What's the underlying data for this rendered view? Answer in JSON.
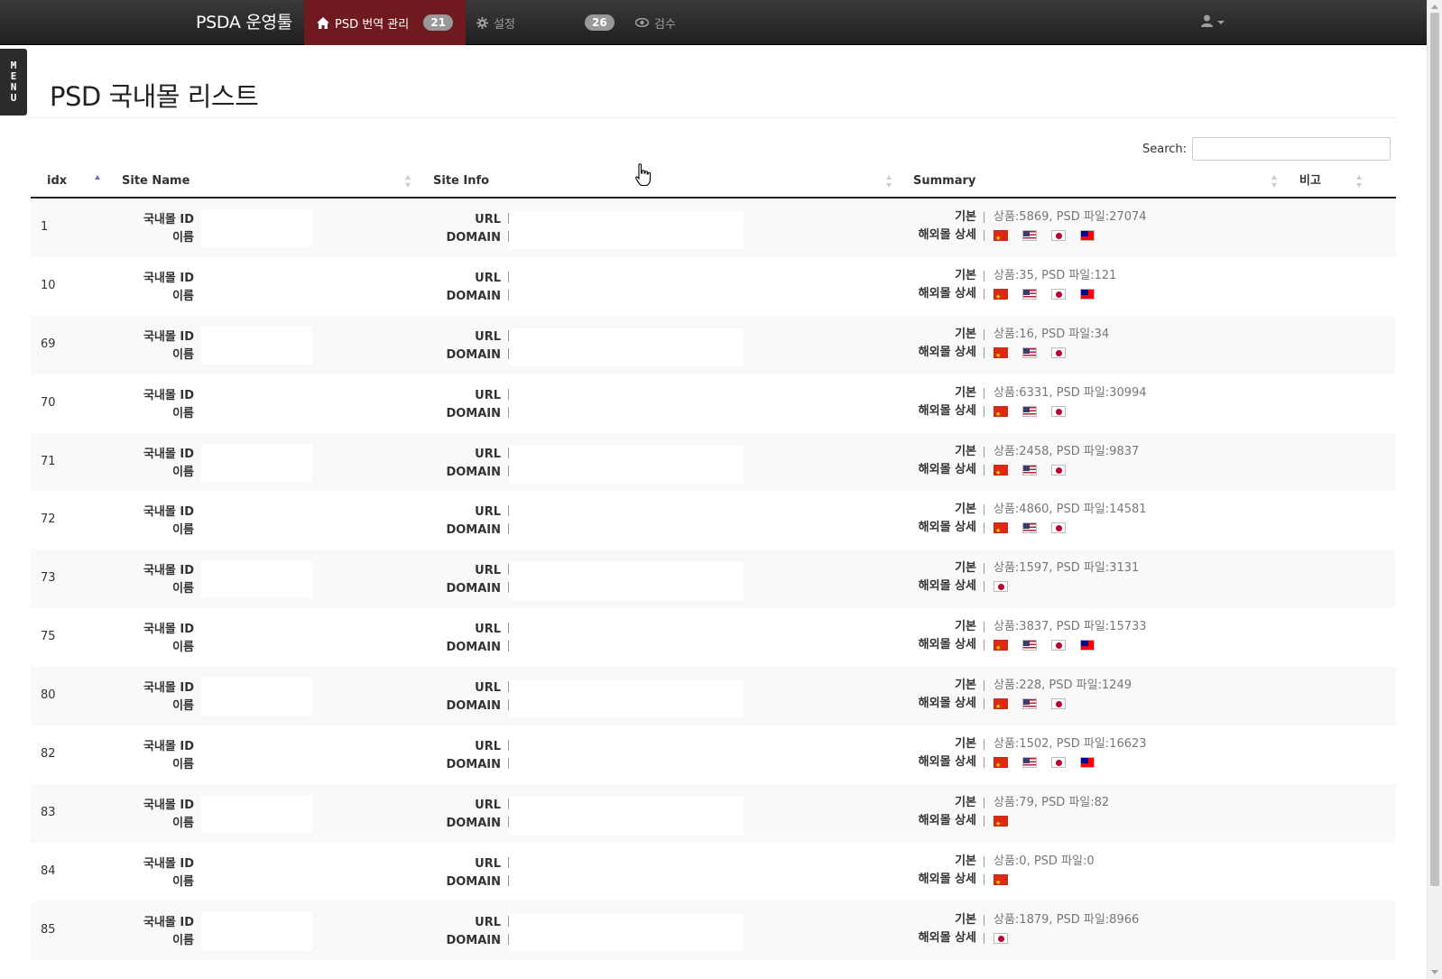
{
  "navbar": {
    "brand": "PSDA 운영툴",
    "items": [
      {
        "label": "PSD 번역 관리",
        "icon": "home-icon",
        "badge": "21",
        "active": true
      },
      {
        "label": "설정",
        "icon": "gear-icon",
        "badge": "26",
        "active": false
      },
      {
        "label": "검수",
        "icon": "eye-icon",
        "active": false
      }
    ],
    "user_icon": "user-icon",
    "colors": {
      "background": "#222222",
      "active_item": "#6f1a1f",
      "badge": "#999999"
    }
  },
  "side_menu": {
    "label": "MENU"
  },
  "page": {
    "title": "PSD 국내몰 리스트"
  },
  "search": {
    "label": "Search:",
    "value": ""
  },
  "table": {
    "columns": [
      "idx",
      "Site Name",
      "Site Info",
      "Summary",
      "비고"
    ],
    "sorted_column": "idx",
    "sort_direction": "asc",
    "field_labels": {
      "mall_id": "국내몰 ID",
      "name": "이름",
      "url": "URL",
      "domain": "DOMAIN",
      "basic": "기본",
      "overseas_detail": "해외몰 상세"
    },
    "rows": [
      {
        "idx": "1",
        "summary": "상품:5869, PSD 파일:27074",
        "flags": [
          "cn",
          "us",
          "jp",
          "tw"
        ]
      },
      {
        "idx": "10",
        "summary": "상품:35, PSD 파일:121",
        "flags": [
          "cn",
          "us",
          "jp",
          "tw"
        ]
      },
      {
        "idx": "69",
        "summary": "상품:16, PSD 파일:34",
        "flags": [
          "cn",
          "us",
          "jp"
        ]
      },
      {
        "idx": "70",
        "summary": "상품:6331, PSD 파일:30994",
        "flags": [
          "cn",
          "us",
          "jp"
        ]
      },
      {
        "idx": "71",
        "summary": "상품:2458, PSD 파일:9837",
        "flags": [
          "cn",
          "us",
          "jp"
        ]
      },
      {
        "idx": "72",
        "summary": "상품:4860, PSD 파일:14581",
        "flags": [
          "cn",
          "us",
          "jp"
        ]
      },
      {
        "idx": "73",
        "summary": "상품:1597, PSD 파일:3131",
        "flags": [
          "jp"
        ]
      },
      {
        "idx": "75",
        "summary": "상품:3837, PSD 파일:15733",
        "flags": [
          "cn",
          "us",
          "jp",
          "tw"
        ]
      },
      {
        "idx": "80",
        "summary": "상품:228, PSD 파일:1249",
        "flags": [
          "cn",
          "us",
          "jp"
        ]
      },
      {
        "idx": "82",
        "summary": "상품:1502, PSD 파일:16623",
        "flags": [
          "cn",
          "us",
          "jp",
          "tw"
        ]
      },
      {
        "idx": "83",
        "summary": "상품:79, PSD 파일:82",
        "flags": [
          "cn"
        ]
      },
      {
        "idx": "84",
        "summary": "상품:0, PSD 파일:0",
        "flags": [
          "cn"
        ]
      },
      {
        "idx": "85",
        "summary": "상품:1879, PSD 파일:8966",
        "flags": [
          "jp"
        ]
      }
    ]
  }
}
